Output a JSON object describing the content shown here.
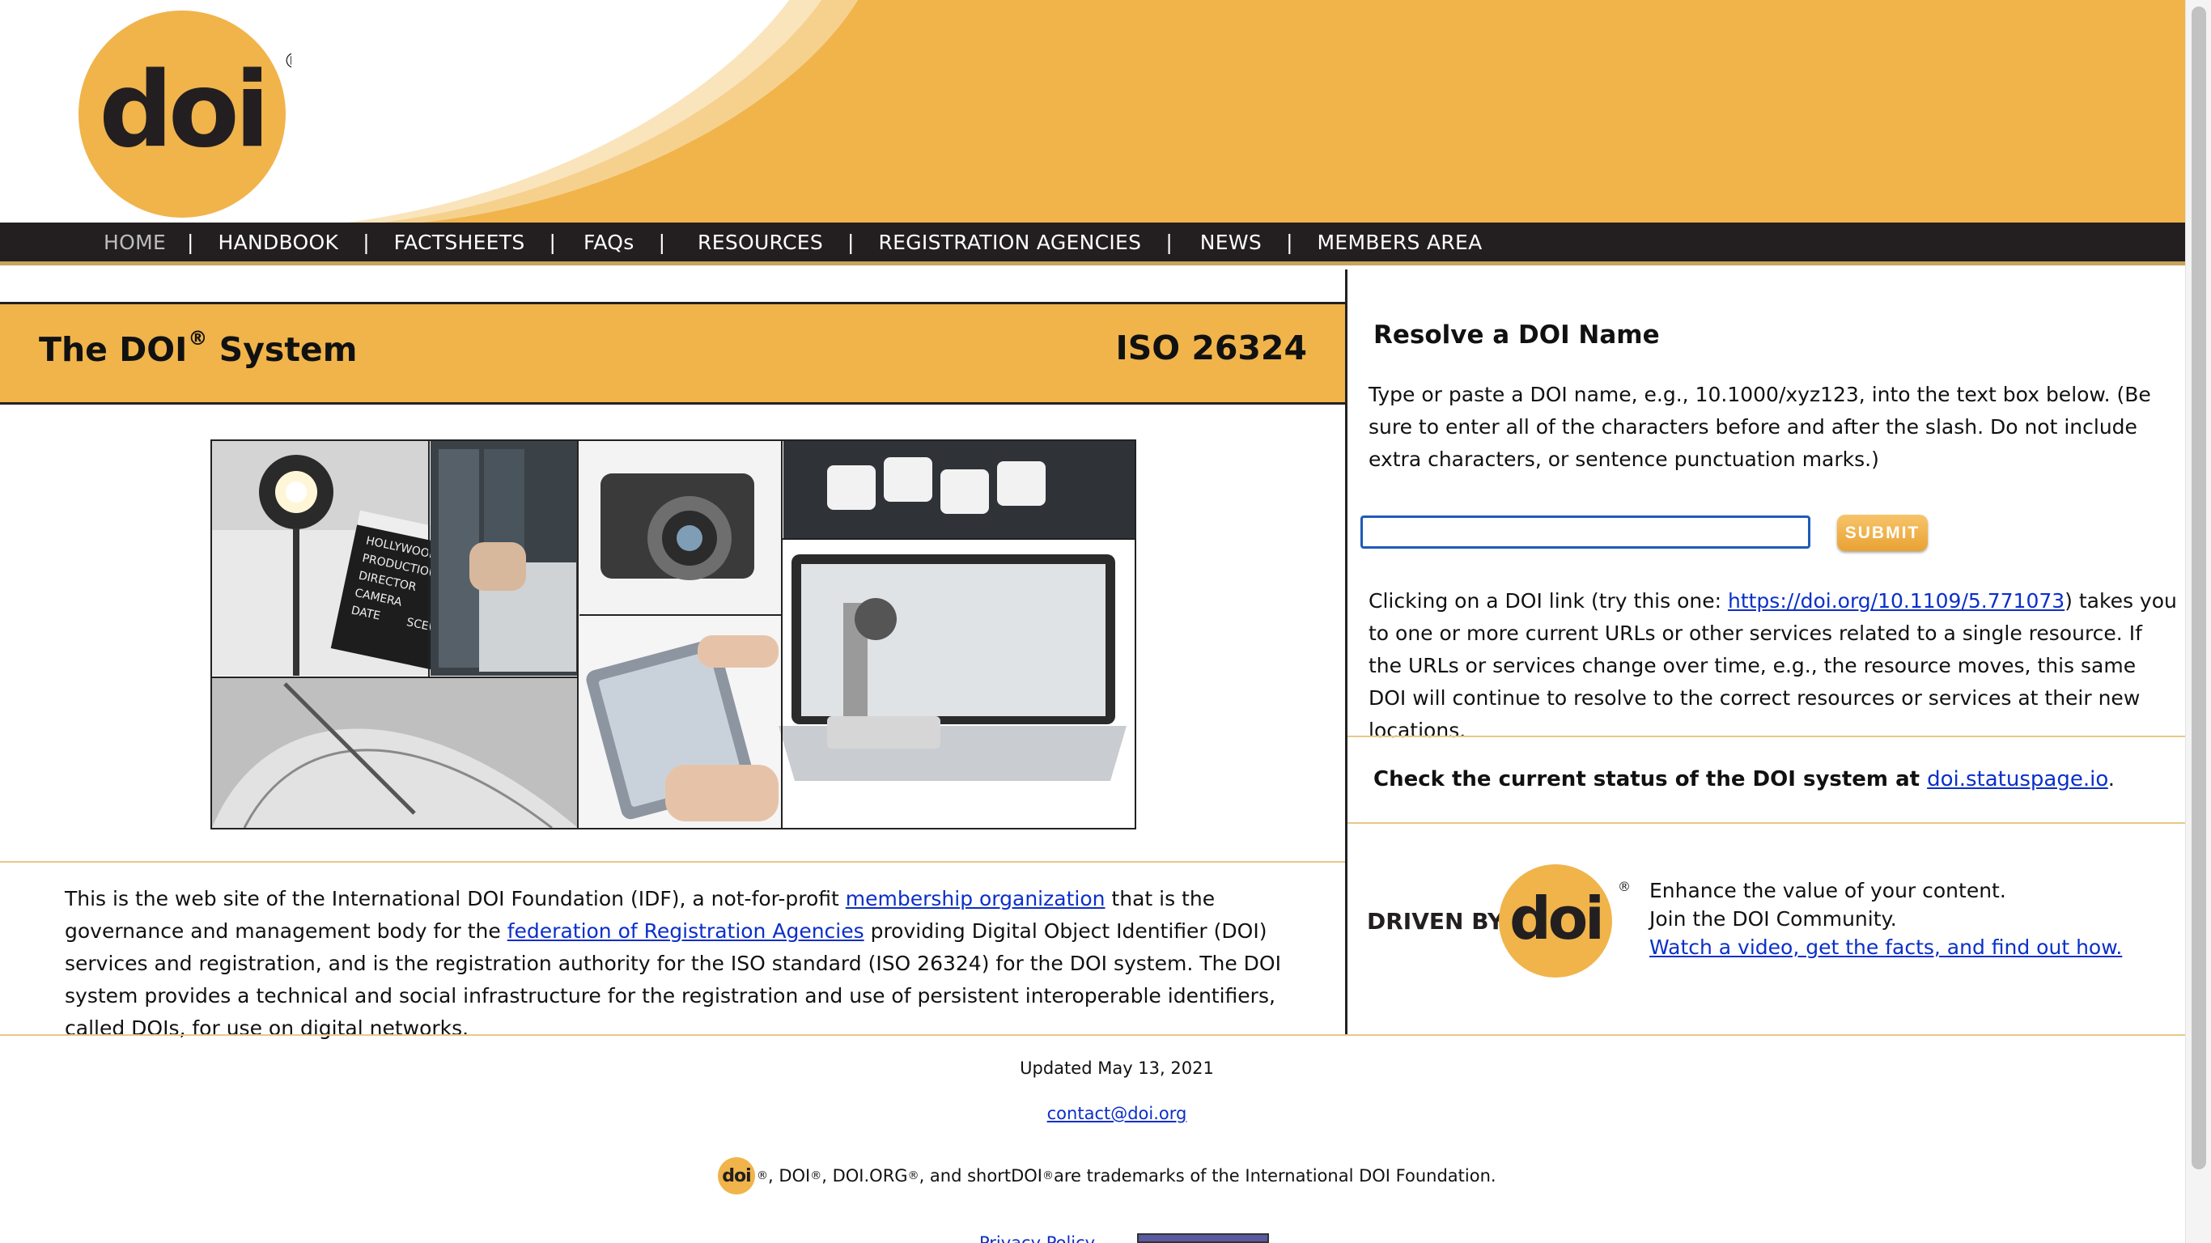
{
  "brand": {
    "logo_text": "doi",
    "accent": "#f0b44b",
    "dark": "#231f20",
    "link": "#0b2fc9"
  },
  "nav": {
    "items": [
      {
        "label": "HOME",
        "active": true
      },
      {
        "label": "HANDBOOK"
      },
      {
        "label": "FACTSHEETS"
      },
      {
        "label": "FAQs"
      },
      {
        "label": "RESOURCES"
      },
      {
        "label": "REGISTRATION AGENCIES"
      },
      {
        "label": "NEWS"
      },
      {
        "label": "MEMBERS AREA"
      }
    ],
    "separator": "|"
  },
  "main": {
    "title": "The DOI",
    "title_sup": "®",
    "title_suffix": " System",
    "iso": "ISO 26324",
    "collage_labels": {
      "clapper_1": "HOLLYWOOD",
      "clapper_2": "PRODUCTION",
      "clapper_3": "DIRECTOR",
      "clapper_4": "CAMERA",
      "clapper_5": "DATE",
      "clapper_6": "SCENE"
    },
    "intro": {
      "t1": "This is the web site of the International DOI Foundation (IDF), a not-for-profit ",
      "link1": "membership organization",
      "t2": " that is the governance and management body for the ",
      "link2": "federation of Registration Agencies",
      "t3": " providing Digital Object Identifier (DOI) services and registration, and is the registration authority for the ISO standard (ISO 26324) for the DOI system. The DOI system provides a technical and social infrastructure for the registration and use of persistent interoperable identifiers, called DOIs, for use on digital networks."
    }
  },
  "resolve": {
    "heading": "Resolve a DOI Name",
    "instructions": "Type or paste a DOI name, e.g., 10.1000/xyz123, into the text box below. (Be sure to enter all of the characters before and after the slash. Do not include extra characters, or sentence punctuation marks.)",
    "input_value": "",
    "submit_label": "SUBMIT",
    "click_t1": "Clicking on a DOI link (try this one: ",
    "click_link": "https://doi.org/10.1109/5.771073",
    "click_t2": ") takes you to one or more current URLs or other services related to a single resource. If the URLs or services change over time, e.g., the resource moves, this same DOI will continue to resolve to the correct resources or services at their new locations."
  },
  "status": {
    "text": "Check the current status of the DOI system at ",
    "link": "doi.statuspage.io",
    "suffix": "."
  },
  "promo": {
    "badge_text": "DRIVEN BY",
    "line1": "Enhance the value of your content.",
    "line2": "Join the DOI Community.",
    "link": "Watch a video, get the facts, and find out how."
  },
  "footer": {
    "updated": "Updated May 13, 2021",
    "contact": "contact@doi.org",
    "tm_1": ", DOI",
    "tm_2": ", DOI.ORG",
    "tm_3": ", and shortDOI",
    "tm_4": " are trademarks of the International DOI Foundation.",
    "reg": "®",
    "privacy_cut": "Privacy Policy"
  }
}
